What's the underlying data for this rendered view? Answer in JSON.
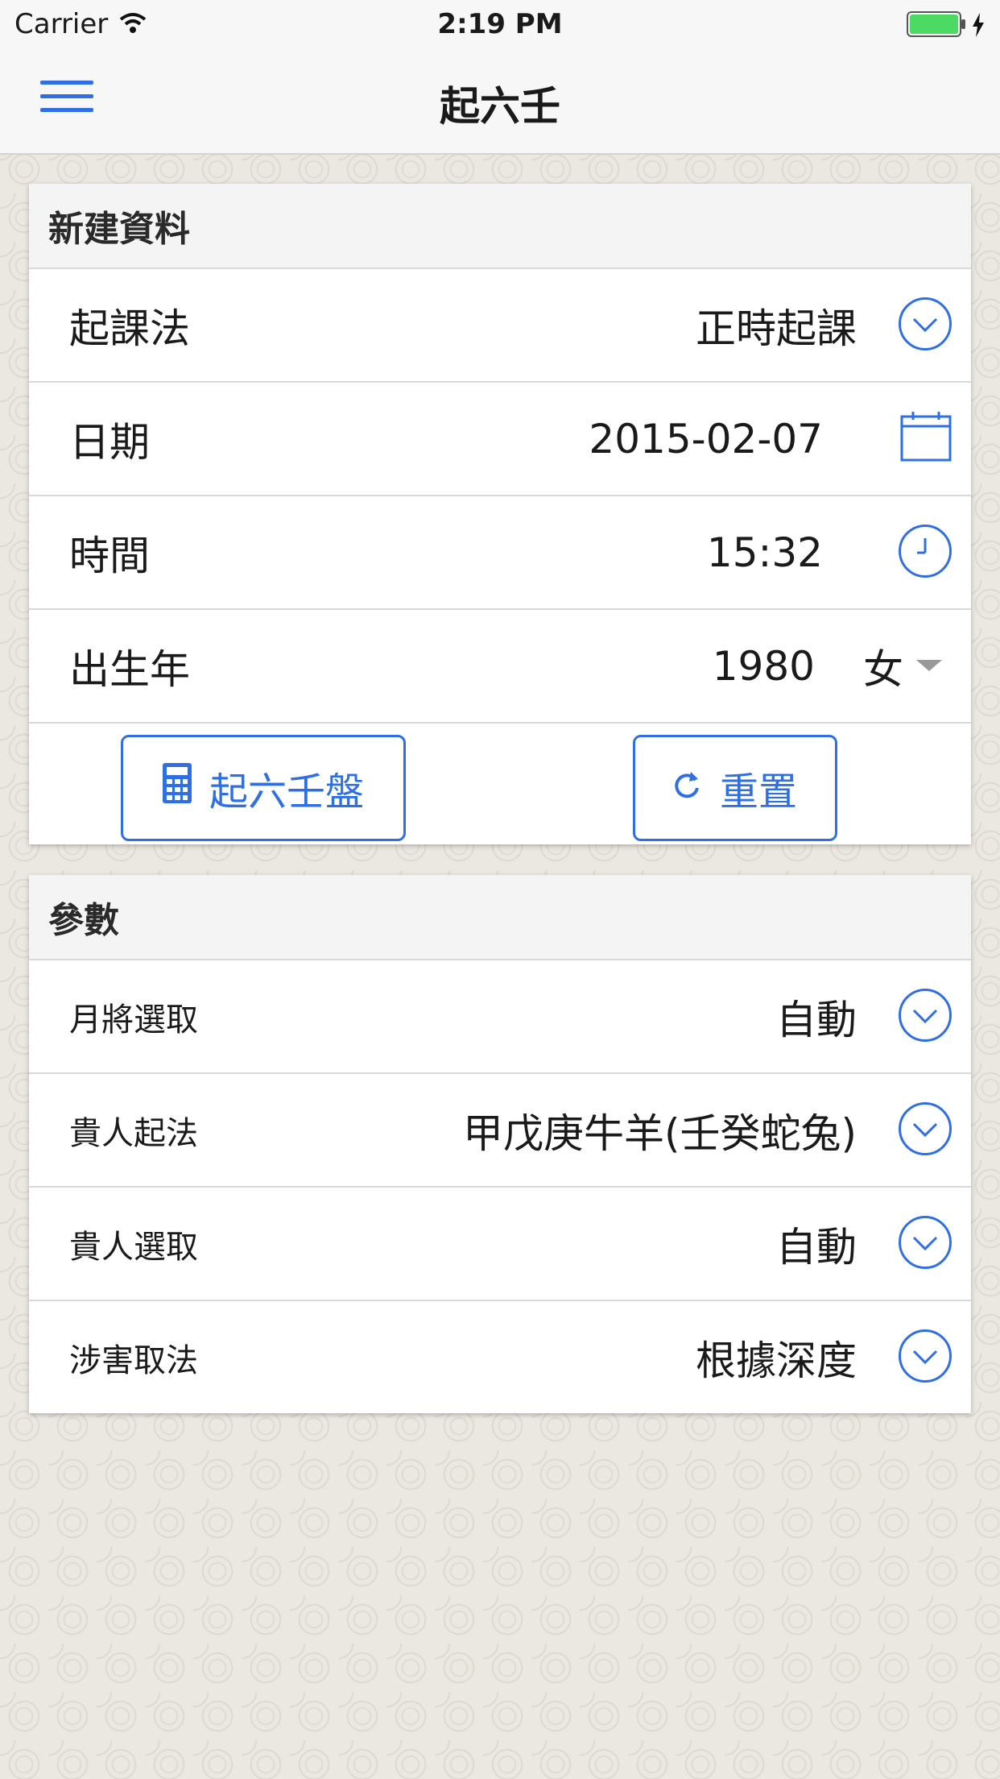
{
  "status_bar": {
    "carrier": "Carrier",
    "time": "2:19 PM"
  },
  "nav": {
    "title": "起六壬",
    "menu_icon": "hamburger-menu-icon"
  },
  "new_data": {
    "header": "新建資料",
    "method_label": "起課法",
    "method_value": "正時起課",
    "date_label": "日期",
    "date_value": "2015-02-07",
    "time_label": "時間",
    "time_value": "15:32",
    "birth_label": "出生年",
    "birth_value": "1980",
    "gender_value": "女",
    "calc_button": "起六壬盤",
    "reset_button": "重置"
  },
  "params": {
    "header": "參數",
    "items": [
      {
        "label": "月將選取",
        "value": "自動"
      },
      {
        "label": "貴人起法",
        "value": "甲戊庚牛羊(壬癸蛇兔)"
      },
      {
        "label": "貴人選取",
        "value": "自動"
      },
      {
        "label": "涉害取法",
        "value": "根據深度"
      }
    ]
  },
  "colors": {
    "accent": "#2f6fe4",
    "battery": "#4cd964"
  }
}
